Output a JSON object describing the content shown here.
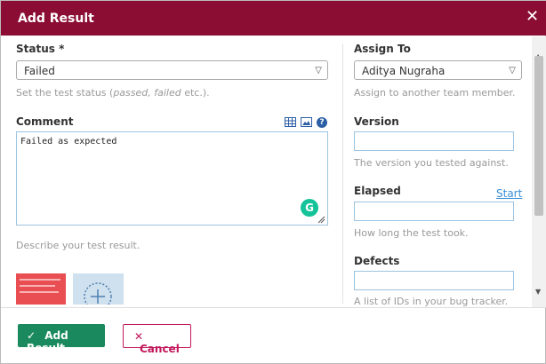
{
  "dialog": {
    "title": "Add Result",
    "close_symbol": "✕"
  },
  "status": {
    "label": "Status *",
    "value": "Failed",
    "hint_prefix": "Set the test status (",
    "hint_em": "passed, failed",
    "hint_suffix": " etc.)."
  },
  "comment": {
    "label": "Comment",
    "value": "Failed as expected",
    "hint": "Describe your test result.",
    "help_symbol": "?"
  },
  "assign": {
    "label": "Assign To",
    "value": "Aditya Nugraha",
    "hint": "Assign to another team member."
  },
  "version": {
    "label": "Version",
    "value": "",
    "hint": "The version you tested against."
  },
  "elapsed": {
    "label": "Elapsed",
    "value": "",
    "start_label": "Start",
    "hint": "How long the test took."
  },
  "defects": {
    "label": "Defects",
    "value": "",
    "hint": "A list of IDs in your bug tracker."
  },
  "footer": {
    "add_label": "Add Result",
    "cancel_label": "Cancel",
    "add_icon": "✓",
    "cancel_icon": "✕"
  },
  "colors": {
    "titlebar": "#8b0d34",
    "add_button": "#1a8a5e",
    "cancel_border": "#c2185b"
  }
}
